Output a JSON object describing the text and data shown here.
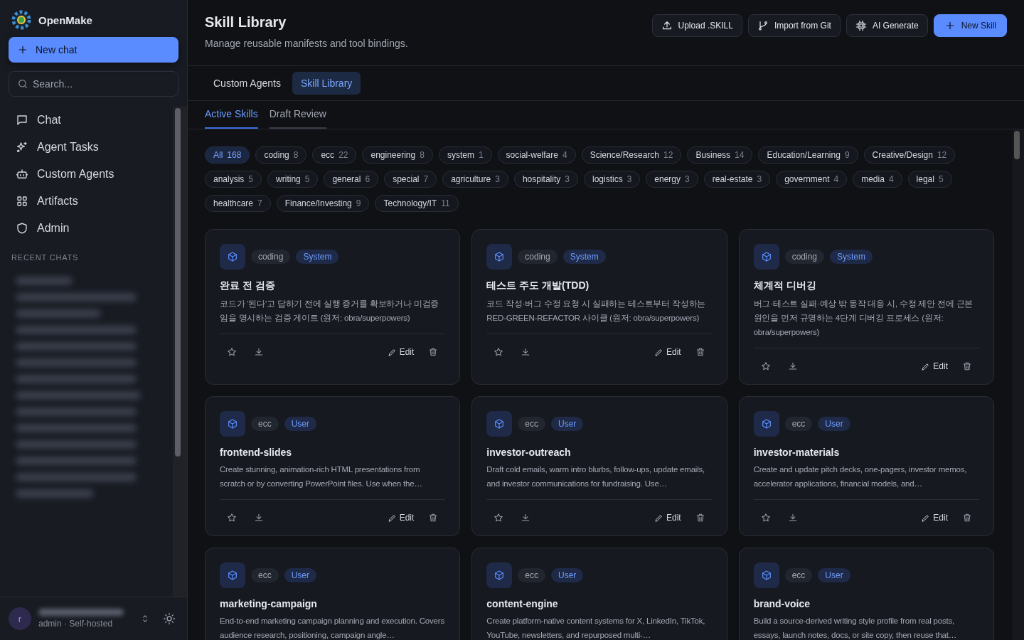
{
  "app": {
    "name": "OpenMake"
  },
  "new_chat": {
    "label": "New chat"
  },
  "search": {
    "placeholder": "Search..."
  },
  "nav": [
    {
      "label": "Chat",
      "selected": false
    },
    {
      "label": "Agent Tasks",
      "selected": false
    },
    {
      "label": "Custom Agents",
      "selected": false
    },
    {
      "label": "Artifacts",
      "selected": false
    },
    {
      "label": "Admin",
      "selected": false
    }
  ],
  "recent_chats": {
    "heading": "RECENT CHATS",
    "items": [
      {
        "kind": "redacted"
      },
      {
        "kind": "redacted"
      },
      {
        "kind": "redacted"
      },
      {
        "kind": "redacted"
      },
      {
        "kind": "redacted"
      },
      {
        "kind": "redacted"
      },
      {
        "kind": "redacted"
      },
      {
        "kind": "redacted"
      },
      {
        "kind": "redacted"
      },
      {
        "kind": "redacted"
      },
      {
        "kind": "redacted"
      },
      {
        "kind": "redacted"
      },
      {
        "kind": "redacted"
      },
      {
        "kind": "redacted"
      }
    ]
  },
  "account": {
    "avatar": "r",
    "name_redacted": true,
    "role": "admin · Self-hosted"
  },
  "header": {
    "title": "Skill Library",
    "subtitle": "Manage reusable manifests and tool bindings."
  },
  "actions": [
    {
      "label": "Upload .SKILL",
      "primary": false
    },
    {
      "label": "Import from Git",
      "primary": false
    },
    {
      "label": "AI Generate",
      "primary": false
    },
    {
      "label": "New Skill",
      "primary": true
    }
  ],
  "tabs": [
    {
      "label": "Custom Agents",
      "selected": false
    },
    {
      "label": "Skill Library",
      "selected": true
    }
  ],
  "subtabs": [
    {
      "label": "Active Skills",
      "selected": true
    },
    {
      "label": "Draft Review",
      "selected": false
    }
  ],
  "filters": [
    {
      "label": "All",
      "count": "168",
      "selected": true
    },
    {
      "label": "coding",
      "count": "8",
      "selected": false
    },
    {
      "label": "ecc",
      "count": "22",
      "selected": false
    },
    {
      "label": "engineering",
      "count": "8",
      "selected": false
    },
    {
      "label": "system",
      "count": "1",
      "selected": false
    },
    {
      "label": "social-welfare",
      "count": "4",
      "selected": false
    },
    {
      "label": "Science/Research",
      "count": "12",
      "selected": false
    },
    {
      "label": "Business",
      "count": "14",
      "selected": false
    },
    {
      "label": "Education/Learning",
      "count": "9",
      "selected": false
    },
    {
      "label": "Creative/Design",
      "count": "12",
      "selected": false
    },
    {
      "label": "analysis",
      "count": "5",
      "selected": false
    },
    {
      "label": "writing",
      "count": "5",
      "selected": false
    },
    {
      "label": "general",
      "count": "6",
      "selected": false
    },
    {
      "label": "special",
      "count": "7",
      "selected": false
    },
    {
      "label": "agriculture",
      "count": "3",
      "selected": false
    },
    {
      "label": "hospitality",
      "count": "3",
      "selected": false
    },
    {
      "label": "logistics",
      "count": "3",
      "selected": false
    },
    {
      "label": "energy",
      "count": "3",
      "selected": false
    },
    {
      "label": "real-estate",
      "count": "3",
      "selected": false
    },
    {
      "label": "government",
      "count": "4",
      "selected": false
    },
    {
      "label": "media",
      "count": "4",
      "selected": false
    },
    {
      "label": "legal",
      "count": "5",
      "selected": false
    },
    {
      "label": "healthcare",
      "count": "7",
      "selected": false
    },
    {
      "label": "Finance/Investing",
      "count": "9",
      "selected": false
    },
    {
      "label": "Technology/IT",
      "count": "11",
      "selected": false
    }
  ],
  "skills": [
    {
      "category": "coding",
      "origin": "System",
      "title": "완료 전 검증",
      "description": "코드가 '된다'고 답하기 전에 실행 증거를 확보하거나 미검증임을 명시하는 검증 게이트 (원저: obra/superpowers)",
      "starred": false,
      "edit": "Edit"
    },
    {
      "category": "coding",
      "origin": "System",
      "title": "테스트 주도 개발(TDD)",
      "description": "코드 작성·버그 수정 요청 시 실패하는 테스트부터 작성하는 RED-GREEN-REFACTOR 사이클 (원저: obra/superpowers)",
      "starred": false,
      "edit": "Edit"
    },
    {
      "category": "coding",
      "origin": "System",
      "title": "체계적 디버깅",
      "description": "버그·테스트 실패·예상 밖 동작 대응 시, 수정 제안 전에 근본 원인을 먼저 규명하는 4단계 디버깅 프로세스 (원저: obra/superpowers)",
      "starred": false,
      "edit": "Edit"
    },
    {
      "category": "ecc",
      "origin": "User",
      "title": "frontend-slides",
      "description": "Create stunning, animation-rich HTML presentations from scratch or by converting PowerPoint files. Use when the…",
      "starred": false,
      "edit": "Edit"
    },
    {
      "category": "ecc",
      "origin": "User",
      "title": "investor-outreach",
      "description": "Draft cold emails, warm intro blurbs, follow-ups, update emails, and investor communications for fundraising. Use…",
      "starred": false,
      "edit": "Edit"
    },
    {
      "category": "ecc",
      "origin": "User",
      "title": "investor-materials",
      "description": "Create and update pitch decks, one-pagers, investor memos, accelerator applications, financial models, and…",
      "starred": false,
      "edit": "Edit"
    },
    {
      "category": "ecc",
      "origin": "User",
      "title": "marketing-campaign",
      "description": "End-to-end marketing campaign planning and execution. Covers audience research, positioning, campaign angle…"
    },
    {
      "category": "ecc",
      "origin": "User",
      "title": "content-engine",
      "description": "Create platform-native content systems for X, LinkedIn, TikTok, YouTube, newsletters, and repurposed multi-…"
    },
    {
      "category": "ecc",
      "origin": "User",
      "title": "brand-voice",
      "description": "Build a source-derived writing style profile from real posts, essays, launch notes, docs, or site copy, then reuse that…"
    }
  ]
}
